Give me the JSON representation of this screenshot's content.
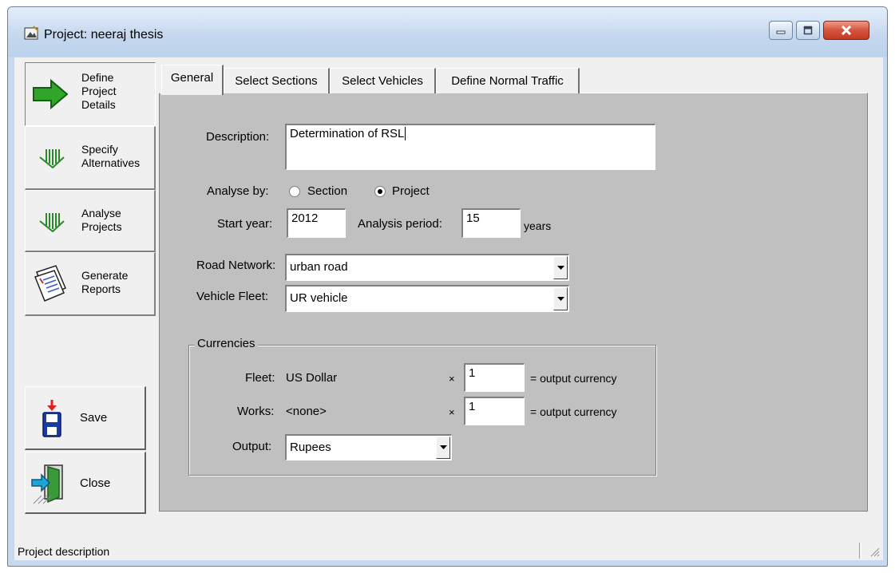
{
  "window": {
    "title": "Project: neeraj thesis"
  },
  "nav": {
    "define_details": [
      "Define",
      "Project",
      "Details"
    ],
    "specify_alternatives": [
      "Specify",
      "Alternatives"
    ],
    "analyse_projects": [
      "Analyse",
      "Projects"
    ],
    "generate_reports": [
      "Generate",
      "Reports"
    ],
    "save": "Save",
    "close": "Close"
  },
  "tabs": [
    {
      "label": "General",
      "active": true
    },
    {
      "label": "Select Sections",
      "active": false
    },
    {
      "label": "Select Vehicles",
      "active": false
    },
    {
      "label": "Define Normal Traffic",
      "active": false
    }
  ],
  "general": {
    "description_label": "Description:",
    "description_value": "Determination of RSL",
    "analyse_by_label": "Analyse by:",
    "analyse_by_options": [
      "Section",
      "Project"
    ],
    "analyse_by_selected": "Project",
    "start_year_label": "Start year:",
    "start_year_value": "2012",
    "analysis_period_label": "Analysis period:",
    "analysis_period_value": "15",
    "analysis_period_unit": "years",
    "road_network_label": "Road Network:",
    "road_network_value": "urban road",
    "vehicle_fleet_label": "Vehicle Fleet:",
    "vehicle_fleet_value": "UR vehicle"
  },
  "currencies": {
    "group_title": "Currencies",
    "fleet_label": "Fleet:",
    "fleet_value": "US Dollar",
    "fleet_multiplier": "1",
    "works_label": "Works:",
    "works_value": "<none>",
    "works_multiplier": "1",
    "times_symbol": "×",
    "output_currency_suffix": "= output currency",
    "output_label": "Output:",
    "output_value": "Rupees"
  },
  "status": {
    "text": "Project description"
  }
}
